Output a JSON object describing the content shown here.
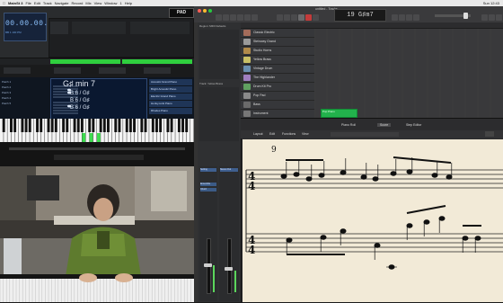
{
  "menubar": {
    "app": "MainSt 3",
    "items": [
      "File",
      "Edit",
      "Track",
      "Navigate",
      "Record",
      "Mix",
      "View",
      "Window",
      "1",
      "Help"
    ],
    "right": "Sun 12:43"
  },
  "mainstage": {
    "lcd_value": "00.00.00.00",
    "lcd_small": "BB 1 100 PM",
    "logo": "PAD",
    "chord_name": "G♯ min 7",
    "chord_notes": [
      "B 6 / G♯",
      "B 6 / G♯",
      "B 6 / G♯"
    ],
    "patch_list": [
      "Patch 1",
      "Patch 2",
      "Patch 3",
      "Patch 4",
      "Patch 5"
    ],
    "patches": [
      "Acoustic Grand Piano",
      "Bright Acoustic Piano",
      "Electric Grand Piano",
      "Honky-tonk Piano",
      "Rhodes Piano"
    ]
  },
  "logic": {
    "title": "untitled - Tracks",
    "lcd": "19  G♯m7",
    "inspector_labels": [
      "Region: MIDI Defaults",
      "Track: Yellow Brass"
    ],
    "tracks": [
      {
        "name": "Classic Electric",
        "color": "#a46c5a"
      },
      {
        "name": "Steinway Grand",
        "color": "#9a9a9a"
      },
      {
        "name": "Studio Horns",
        "color": "#b08a4a"
      },
      {
        "name": "Yellow Brass",
        "color": "#c9c066"
      },
      {
        "name": "Vintage Drum",
        "color": "#6a8fb0"
      },
      {
        "name": "The Highlander",
        "color": "#a07fc0"
      },
      {
        "name": "Drum Kit Pro",
        "color": "#60a060"
      },
      {
        "name": "Pop Pad",
        "color": "#8a8a8a"
      },
      {
        "name": "Bass",
        "color": "#6a6a6a"
      },
      {
        "name": "Instrument",
        "color": "#777777"
      },
      {
        "name": "Drummer",
        "color": "#777777"
      }
    ],
    "region_label": "Pop Piano",
    "editor_tabs": [
      "Piano Roll",
      "Score",
      "Step Editor"
    ],
    "editor_menu": [
      "Layout",
      "Edit",
      "Functions",
      "View"
    ],
    "measure_number": "9",
    "time_signature": {
      "top": "4",
      "bottom": "4"
    },
    "channel_labels": [
      "Setting",
      "Ensemble",
      "Chord",
      "Stereo Out"
    ],
    "colors": {
      "region": "#22b24c",
      "score_bg": "#f2ead7",
      "accent": "#2fcf3e"
    }
  }
}
